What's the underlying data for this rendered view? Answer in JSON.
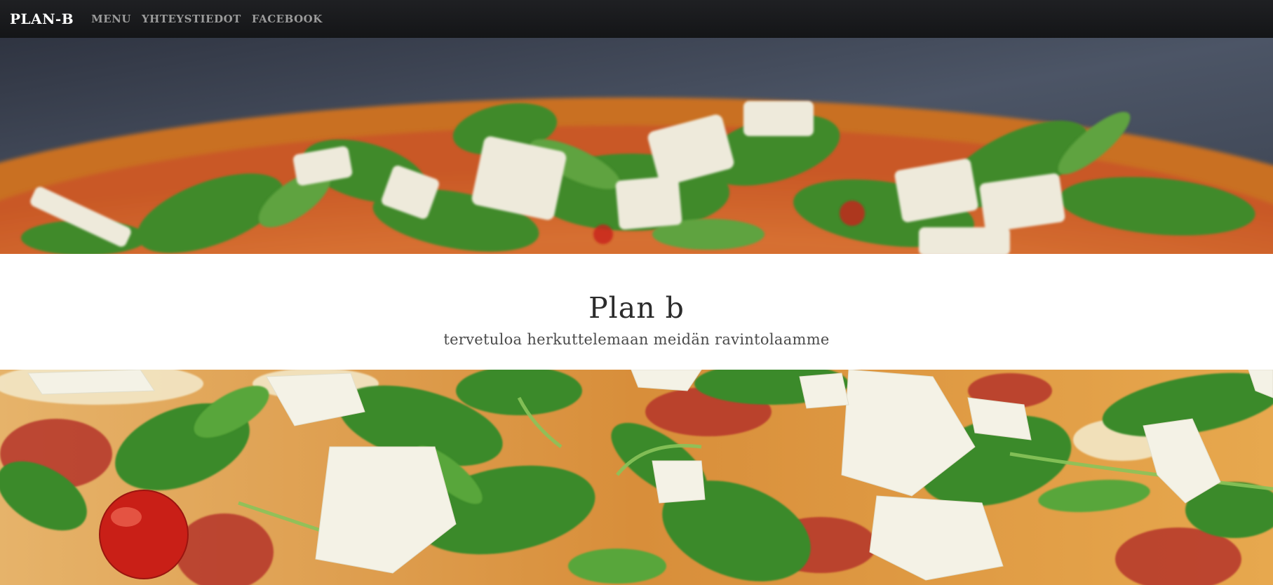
{
  "navbar": {
    "brand": "PLAN-B",
    "links": [
      "MENU",
      "YHTEYSTIEDOT",
      "FACEBOOK"
    ]
  },
  "intro": {
    "title": "Plan b",
    "subtitle": "tervetuloa herkuttelemaan meidän ravintolaamme"
  },
  "images": {
    "top": "pizza-photo-top",
    "bottom": "pizza-photo-bottom"
  },
  "colors": {
    "navbar": "#1a1b1e",
    "brand": "#ffffff",
    "nav_link": "#9b9b9b",
    "title": "#2b2b2b",
    "arugula": "#3f8a2c",
    "crust": "#e3a23a",
    "cheese": "#f1efe0",
    "tomato": "#c8221a"
  }
}
